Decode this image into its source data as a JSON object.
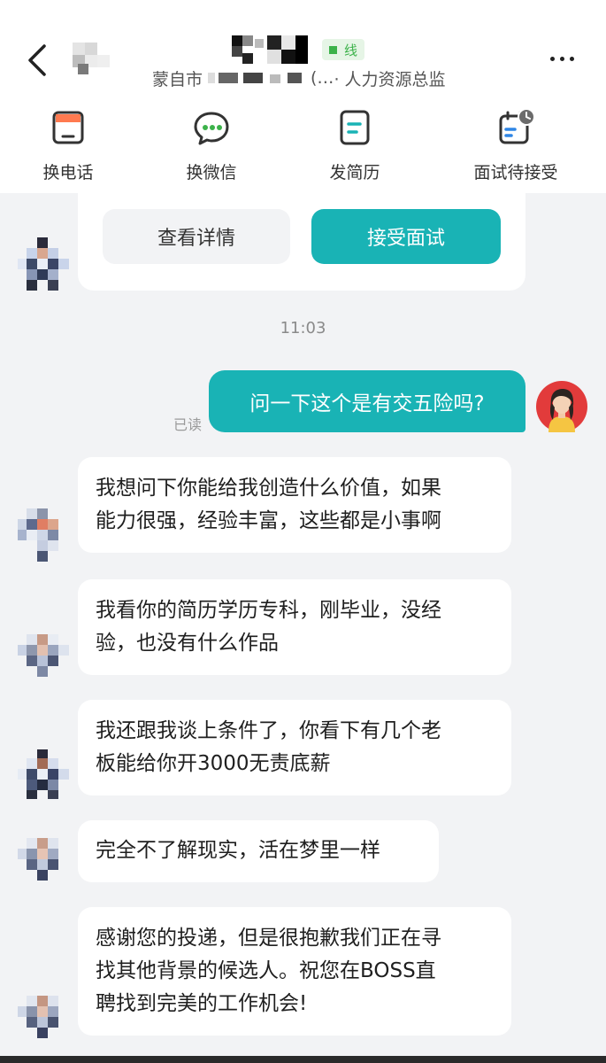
{
  "header": {
    "status_text": "线",
    "subtitle_prefix": "蒙自市",
    "subtitle_ellipsis": "(…",
    "subtitle_suffix": "· 人力资源总监"
  },
  "actions": [
    {
      "label": "换电话",
      "icon": "phone-icon"
    },
    {
      "label": "换微信",
      "icon": "wechat-icon"
    },
    {
      "label": "发简历",
      "icon": "resume-icon"
    },
    {
      "label": "面试待接受",
      "icon": "calendar-clock-icon"
    }
  ],
  "card": {
    "view_details": "查看详情",
    "accept_interview": "接受面试"
  },
  "chat": {
    "time": "11:03",
    "sent_message": "问一下这个是有交五险吗?",
    "read_status": "已读",
    "received": [
      {
        "line1": "我想问下你能给我创造什么价值，如果",
        "line2": "能力很强，经验丰富，这些都是小事啊"
      },
      {
        "line1": "我看你的简历学历专科，刚毕业，没经",
        "line2": "验，也没有什么作品"
      },
      {
        "line1": "我还跟我谈上条件了，你看下有几个老",
        "line2": "板能给你开3000无责底薪"
      },
      {
        "line1": "完全不了解现实，活在梦里一样"
      },
      {
        "line1": "感谢您的投递，但是很抱歉我们正在寻",
        "line2": "找其他背景的候选人。祝您在BOSS直",
        "line3": "聘找到完美的工作机会!"
      }
    ]
  },
  "colors": {
    "accent": "#19b3b5",
    "online": "#3cb24a",
    "background": "#f2f3f5"
  }
}
